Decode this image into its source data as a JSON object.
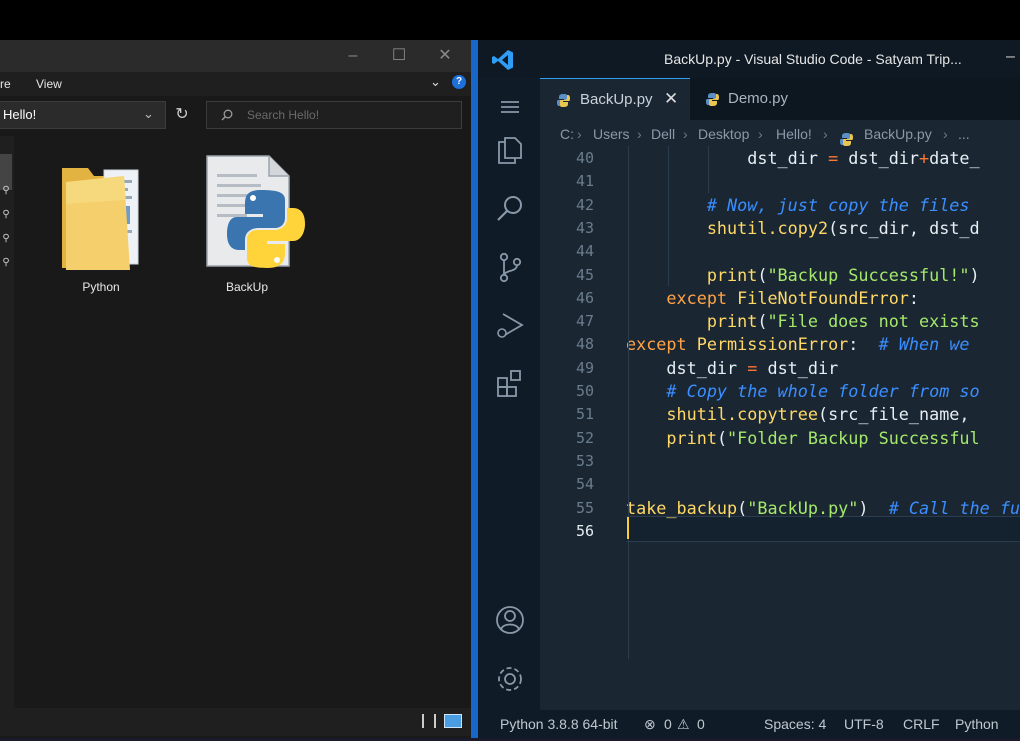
{
  "explorer": {
    "ribbon": {
      "partial_tab": "re",
      "view_tab": "View"
    },
    "address": "Hello!",
    "search_placeholder": "Search Hello!",
    "items": [
      {
        "label": "Python",
        "icon": "folder-icon"
      },
      {
        "label": "BackUp",
        "icon": "python-file-icon"
      }
    ]
  },
  "vscode": {
    "window_title": "BackUp.py - Visual Studio Code - Satyam Trip...",
    "tabs": [
      {
        "label": "BackUp.py",
        "active": true
      },
      {
        "label": "Demo.py",
        "active": false
      }
    ],
    "breadcrumb": [
      "C:",
      "Users",
      "Dell",
      "Desktop",
      "Hello!",
      "BackUp.py",
      "..."
    ],
    "line_numbers": [
      "40",
      "41",
      "42",
      "43",
      "44",
      "45",
      "46",
      "47",
      "48",
      "49",
      "50",
      "51",
      "52",
      "53",
      "54",
      "55",
      "56"
    ],
    "code": [
      [
        [
          "pl",
          "            dst_dir "
        ],
        [
          "op",
          "="
        ],
        [
          "pl",
          " dst_dir"
        ],
        [
          "op",
          "+"
        ],
        [
          "pl",
          "date_"
        ]
      ],
      [],
      [
        [
          "com",
          "        # Now, just copy the files"
        ]
      ],
      [
        [
          "fn",
          "        shutil.copy2"
        ],
        [
          "pl",
          "(src_dir, dst_d"
        ]
      ],
      [],
      [
        [
          "fn",
          "        print"
        ],
        [
          "pl",
          "("
        ],
        [
          "str",
          "\"Backup Successful!\""
        ],
        [
          "pl",
          ")"
        ]
      ],
      [
        [
          "kw",
          "    except "
        ],
        [
          "cls",
          "FileNotFoundError"
        ],
        [
          "pl",
          ":"
        ]
      ],
      [
        [
          "fn",
          "        print"
        ],
        [
          "pl",
          "("
        ],
        [
          "str",
          "\"File does not exists"
        ]
      ],
      [
        [
          "kw",
          "except "
        ],
        [
          "cls",
          "PermissionError"
        ],
        [
          "pl",
          ":  "
        ],
        [
          "com",
          "# When we"
        ]
      ],
      [
        [
          "pl",
          "    dst_dir "
        ],
        [
          "op",
          "="
        ],
        [
          "pl",
          " dst_dir"
        ]
      ],
      [
        [
          "com",
          "    # Copy the whole folder from so"
        ]
      ],
      [
        [
          "fn",
          "    shutil.copytree"
        ],
        [
          "pl",
          "(src_file_name,"
        ]
      ],
      [
        [
          "fn",
          "    print"
        ],
        [
          "pl",
          "("
        ],
        [
          "str",
          "\"Folder Backup Successful"
        ]
      ],
      [],
      [],
      [
        [
          "fn",
          "take_backup"
        ],
        [
          "pl",
          "("
        ],
        [
          "str",
          "\"BackUp.py\""
        ],
        [
          "pl",
          ")  "
        ],
        [
          "com",
          "# Call the fu"
        ]
      ],
      []
    ],
    "status": {
      "interpreter": "Python 3.8.8 64-bit",
      "errors": "0",
      "warnings": "0",
      "spaces": "Spaces: 4",
      "encoding": "UTF-8",
      "eol": "CRLF",
      "language": "Python"
    },
    "colors": {
      "accent": "#0078d4",
      "background": "#1a2733"
    }
  }
}
